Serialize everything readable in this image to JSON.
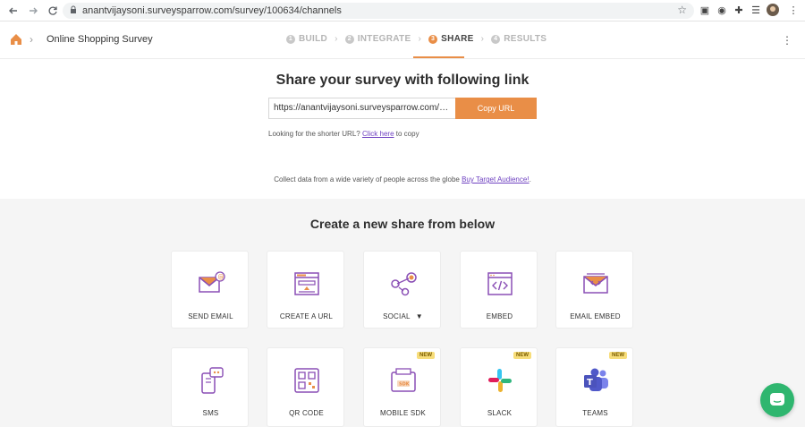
{
  "browser": {
    "url": "anantvijaysoni.surveysparrow.com/survey/100634/channels"
  },
  "header": {
    "survey_title": "Online Shopping Survey",
    "steps": [
      {
        "num": "1",
        "label": "BUILD"
      },
      {
        "num": "2",
        "label": "INTEGRATE"
      },
      {
        "num": "3",
        "label": "SHARE"
      },
      {
        "num": "4",
        "label": "RESULTS"
      }
    ],
    "active_step": "SHARE"
  },
  "share": {
    "title": "Share your survey with following link",
    "link_value": "https://anantvijaysoni.surveysparrow.com/s/...",
    "copy_label": "Copy URL",
    "shorter_text": "Looking for the shorter URL?",
    "shorter_link": "Click here",
    "shorter_suffix": "to copy",
    "collect_text": "Collect data from a wide variety of people across the globe",
    "collect_link": "Buy Target Audience!",
    "collect_suffix": "."
  },
  "grid": {
    "title": "Create a new share from below",
    "row1": [
      {
        "label": "SEND EMAIL",
        "icon": "send-email-icon"
      },
      {
        "label": "CREATE A URL",
        "icon": "create-url-icon"
      },
      {
        "label": "SOCIAL",
        "icon": "social-icon"
      },
      {
        "label": "EMBED",
        "icon": "embed-icon"
      },
      {
        "label": "EMAIL EMBED",
        "icon": "email-embed-icon"
      }
    ],
    "row2": [
      {
        "label": "SMS",
        "icon": "sms-icon"
      },
      {
        "label": "QR CODE",
        "icon": "qr-code-icon"
      },
      {
        "label": "MOBILE SDK",
        "icon": "mobile-sdk-icon",
        "badge": "NEW"
      },
      {
        "label": "SLACK",
        "icon": "slack-icon",
        "badge": "NEW"
      },
      {
        "label": "TEAMS",
        "icon": "teams-icon",
        "badge": "NEW"
      }
    ]
  },
  "colors": {
    "accent": "#e98e47",
    "purple": "#8a4fb5",
    "link": "#6f42c1",
    "chat": "#2fb66f"
  }
}
